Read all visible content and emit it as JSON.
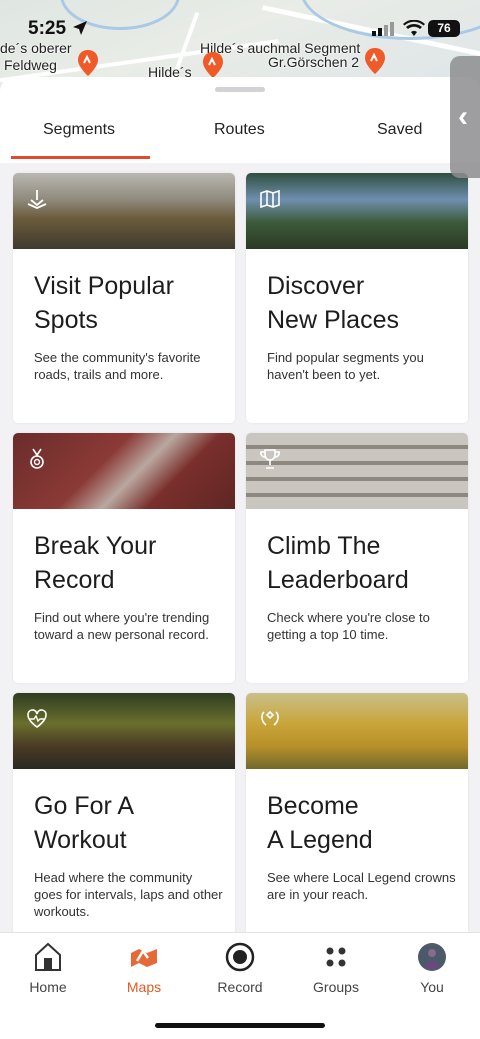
{
  "status_bar": {
    "time": "5:25",
    "battery": "76"
  },
  "map": {
    "labels": [
      "de´s oberer",
      "Feldweg",
      "Hilde´s",
      "Hilde´s auchmal Segment",
      "Gr.Görschen 2"
    ]
  },
  "tabs": [
    {
      "label": "Segments",
      "active": true
    },
    {
      "label": "Routes",
      "active": false
    },
    {
      "label": "Saved",
      "active": false
    }
  ],
  "cards": [
    {
      "title_line1": "Visit Popular",
      "title_line2": "Spots",
      "description": "See the community's favorite roads, trails and more.",
      "icon": "map-pin-icon"
    },
    {
      "title_line1": "Discover",
      "title_line2": "New Places",
      "description": "Find popular segments you haven't been to yet.",
      "icon": "map-icon"
    },
    {
      "title_line1": "Break Your",
      "title_line2": "Record",
      "description": "Find out where you're trending toward a new personal record.",
      "icon": "medal-icon"
    },
    {
      "title_line1": "Climb The",
      "title_line2": "Leaderboard",
      "description": "Check where you're close to getting a top 10 time.",
      "icon": "trophy-icon"
    },
    {
      "title_line1": "Go For A",
      "title_line2": "Workout",
      "description": "Head where the community goes for intervals, laps and other workouts.",
      "icon": "heartbeat-icon"
    },
    {
      "title_line1": "Become",
      "title_line2": "A Legend",
      "description": "See where Local Legend crowns are in your reach.",
      "icon": "laurel-icon"
    }
  ],
  "nav": [
    {
      "label": "Home",
      "active": false
    },
    {
      "label": "Maps",
      "active": true
    },
    {
      "label": "Record",
      "active": false
    },
    {
      "label": "Groups",
      "active": false
    },
    {
      "label": "You",
      "active": false
    }
  ],
  "colors": {
    "accent": "#e34a2b",
    "maps_active": "#e35a22"
  }
}
